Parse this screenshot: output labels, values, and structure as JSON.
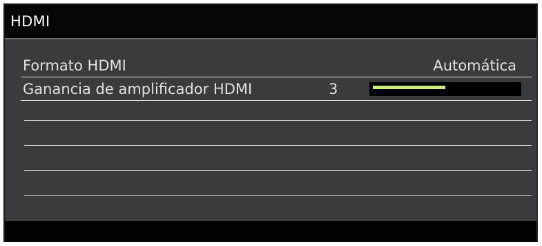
{
  "header": {
    "title": "HDMI"
  },
  "menu": {
    "items": [
      {
        "label": "Formato HDMI",
        "value": "Automática"
      },
      {
        "label": "Ganancia de amplificador HDMI",
        "value": "3",
        "level": 0.5
      }
    ]
  },
  "colors": {
    "panel_background": "#3a3b3d",
    "title_background": "#050505",
    "text": "#dfe0e2",
    "level_bar": "#c8f07a"
  }
}
